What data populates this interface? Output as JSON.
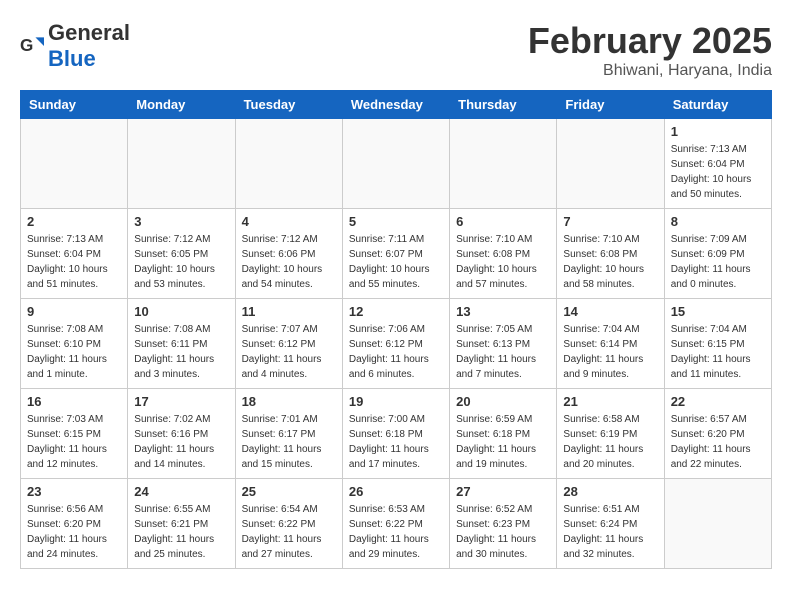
{
  "header": {
    "logo_general": "General",
    "logo_blue": "Blue",
    "month_title": "February 2025",
    "subtitle": "Bhiwani, Haryana, India"
  },
  "weekdays": [
    "Sunday",
    "Monday",
    "Tuesday",
    "Wednesday",
    "Thursday",
    "Friday",
    "Saturday"
  ],
  "weeks": [
    [
      {
        "day": "",
        "info": ""
      },
      {
        "day": "",
        "info": ""
      },
      {
        "day": "",
        "info": ""
      },
      {
        "day": "",
        "info": ""
      },
      {
        "day": "",
        "info": ""
      },
      {
        "day": "",
        "info": ""
      },
      {
        "day": "1",
        "info": "Sunrise: 7:13 AM\nSunset: 6:04 PM\nDaylight: 10 hours\nand 50 minutes."
      }
    ],
    [
      {
        "day": "2",
        "info": "Sunrise: 7:13 AM\nSunset: 6:04 PM\nDaylight: 10 hours\nand 51 minutes."
      },
      {
        "day": "3",
        "info": "Sunrise: 7:12 AM\nSunset: 6:05 PM\nDaylight: 10 hours\nand 53 minutes."
      },
      {
        "day": "4",
        "info": "Sunrise: 7:12 AM\nSunset: 6:06 PM\nDaylight: 10 hours\nand 54 minutes."
      },
      {
        "day": "5",
        "info": "Sunrise: 7:11 AM\nSunset: 6:07 PM\nDaylight: 10 hours\nand 55 minutes."
      },
      {
        "day": "6",
        "info": "Sunrise: 7:10 AM\nSunset: 6:08 PM\nDaylight: 10 hours\nand 57 minutes."
      },
      {
        "day": "7",
        "info": "Sunrise: 7:10 AM\nSunset: 6:08 PM\nDaylight: 10 hours\nand 58 minutes."
      },
      {
        "day": "8",
        "info": "Sunrise: 7:09 AM\nSunset: 6:09 PM\nDaylight: 11 hours\nand 0 minutes."
      }
    ],
    [
      {
        "day": "9",
        "info": "Sunrise: 7:08 AM\nSunset: 6:10 PM\nDaylight: 11 hours\nand 1 minute."
      },
      {
        "day": "10",
        "info": "Sunrise: 7:08 AM\nSunset: 6:11 PM\nDaylight: 11 hours\nand 3 minutes."
      },
      {
        "day": "11",
        "info": "Sunrise: 7:07 AM\nSunset: 6:12 PM\nDaylight: 11 hours\nand 4 minutes."
      },
      {
        "day": "12",
        "info": "Sunrise: 7:06 AM\nSunset: 6:12 PM\nDaylight: 11 hours\nand 6 minutes."
      },
      {
        "day": "13",
        "info": "Sunrise: 7:05 AM\nSunset: 6:13 PM\nDaylight: 11 hours\nand 7 minutes."
      },
      {
        "day": "14",
        "info": "Sunrise: 7:04 AM\nSunset: 6:14 PM\nDaylight: 11 hours\nand 9 minutes."
      },
      {
        "day": "15",
        "info": "Sunrise: 7:04 AM\nSunset: 6:15 PM\nDaylight: 11 hours\nand 11 minutes."
      }
    ],
    [
      {
        "day": "16",
        "info": "Sunrise: 7:03 AM\nSunset: 6:15 PM\nDaylight: 11 hours\nand 12 minutes."
      },
      {
        "day": "17",
        "info": "Sunrise: 7:02 AM\nSunset: 6:16 PM\nDaylight: 11 hours\nand 14 minutes."
      },
      {
        "day": "18",
        "info": "Sunrise: 7:01 AM\nSunset: 6:17 PM\nDaylight: 11 hours\nand 15 minutes."
      },
      {
        "day": "19",
        "info": "Sunrise: 7:00 AM\nSunset: 6:18 PM\nDaylight: 11 hours\nand 17 minutes."
      },
      {
        "day": "20",
        "info": "Sunrise: 6:59 AM\nSunset: 6:18 PM\nDaylight: 11 hours\nand 19 minutes."
      },
      {
        "day": "21",
        "info": "Sunrise: 6:58 AM\nSunset: 6:19 PM\nDaylight: 11 hours\nand 20 minutes."
      },
      {
        "day": "22",
        "info": "Sunrise: 6:57 AM\nSunset: 6:20 PM\nDaylight: 11 hours\nand 22 minutes."
      }
    ],
    [
      {
        "day": "23",
        "info": "Sunrise: 6:56 AM\nSunset: 6:20 PM\nDaylight: 11 hours\nand 24 minutes."
      },
      {
        "day": "24",
        "info": "Sunrise: 6:55 AM\nSunset: 6:21 PM\nDaylight: 11 hours\nand 25 minutes."
      },
      {
        "day": "25",
        "info": "Sunrise: 6:54 AM\nSunset: 6:22 PM\nDaylight: 11 hours\nand 27 minutes."
      },
      {
        "day": "26",
        "info": "Sunrise: 6:53 AM\nSunset: 6:22 PM\nDaylight: 11 hours\nand 29 minutes."
      },
      {
        "day": "27",
        "info": "Sunrise: 6:52 AM\nSunset: 6:23 PM\nDaylight: 11 hours\nand 30 minutes."
      },
      {
        "day": "28",
        "info": "Sunrise: 6:51 AM\nSunset: 6:24 PM\nDaylight: 11 hours\nand 32 minutes."
      },
      {
        "day": "",
        "info": ""
      }
    ]
  ]
}
